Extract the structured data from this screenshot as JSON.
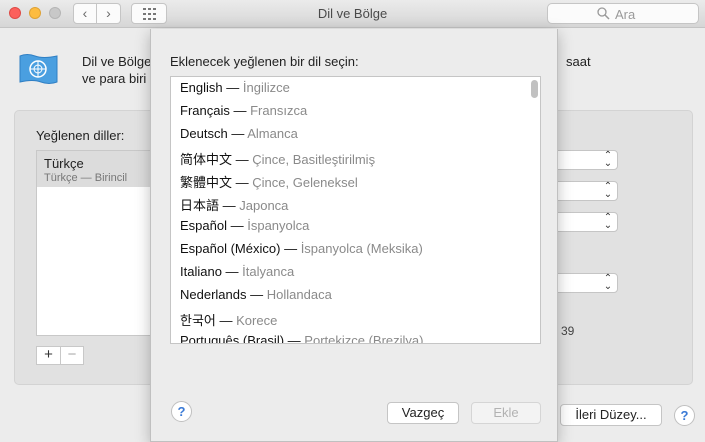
{
  "window": {
    "title": "Dil ve Bölge"
  },
  "toolbar": {
    "back_icon": "chevron-left-icon",
    "forward_icon": "chevron-right-icon",
    "grid_icon": "grid-icon"
  },
  "search": {
    "placeholder": "Ara",
    "icon": "search-icon"
  },
  "header": {
    "line1": "Dil ve Bölge",
    "line2": "ve para biri",
    "line1_right": "saat"
  },
  "preferred": {
    "label": "Yeğlenen diller:",
    "selected": {
      "name": "Türkçe",
      "sub": "Türkçe — Birincil"
    },
    "add_label": "+",
    "remove_label": "−"
  },
  "background": {
    "partial_number": "39"
  },
  "advanced_button": "İleri Düzey...",
  "help_label": "?",
  "sheet": {
    "title": "Eklenecek yeğlenen bir dil seçin:",
    "languages": [
      {
        "native": "English",
        "translated": "İngilizce"
      },
      {
        "native": "Français",
        "translated": "Fransızca"
      },
      {
        "native": "Deutsch",
        "translated": "Almanca"
      },
      {
        "native": "简体中文",
        "translated": "Çince, Basitleştirilmiş"
      },
      {
        "native": "繁體中文",
        "translated": "Çince, Geleneksel"
      },
      {
        "native": "日本語",
        "translated": "Japonca"
      },
      {
        "native": "Español",
        "translated": "İspanyolca"
      },
      {
        "native": "Español (México)",
        "translated": "İspanyolca (Meksika)"
      },
      {
        "native": "Italiano",
        "translated": "İtalyanca"
      },
      {
        "native": "Nederlands",
        "translated": "Hollandaca"
      },
      {
        "native": "한국어",
        "translated": "Korece"
      },
      {
        "native": "Português (Brasil)",
        "translated": "Portekizce (Brezilya)"
      }
    ],
    "separator": "—",
    "cancel_label": "Vazgeç",
    "add_label": "Ekle"
  },
  "colors": {
    "accent": "#3a7ad6",
    "disabled_text": "#b2b2b2"
  }
}
